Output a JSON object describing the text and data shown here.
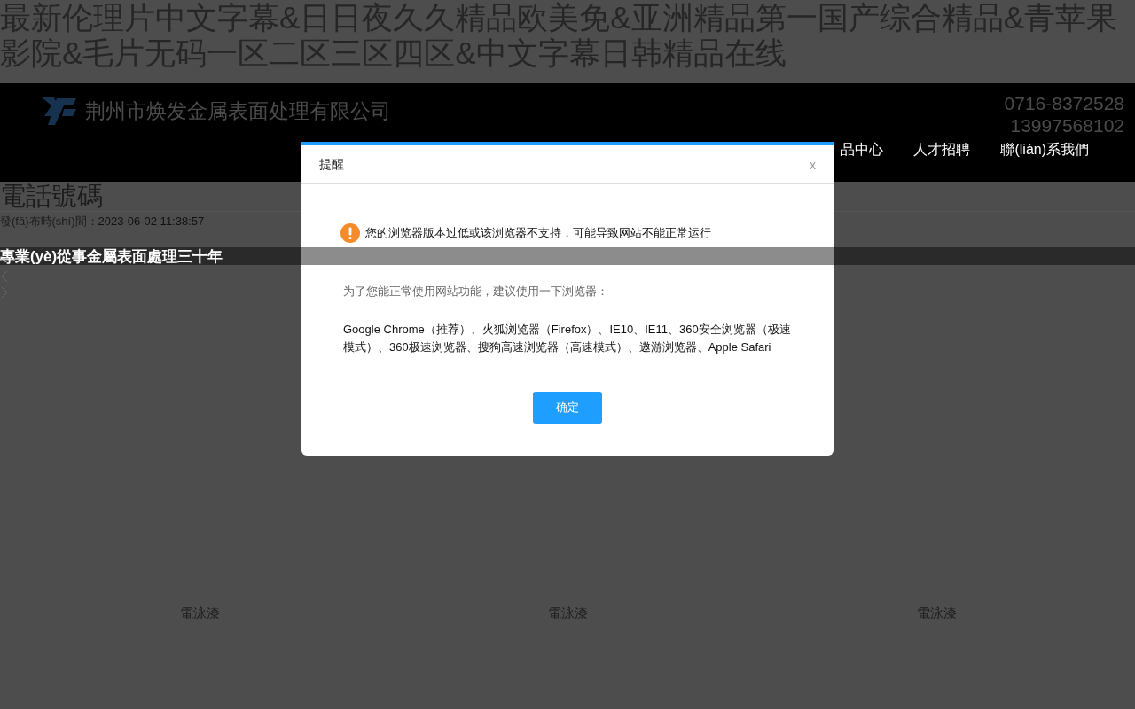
{
  "page_title": "最新伦理片中文字幕&日日夜久久精品欧美免&亚洲精品第一国产综合精品&青苹果影院&毛片无码一区二区三区四区&中文字幕日韩精品在线",
  "header": {
    "company": "荆州市焕发金属表面处理有限公司",
    "phones": [
      "0716-8372528",
      "13997568102"
    ],
    "nav": [
      {
        "label": "品中心"
      },
      {
        "label": "人才招聘"
      },
      {
        "label": "聯(lián)系我們"
      }
    ]
  },
  "article": {
    "title": "電話號碼",
    "date_label": "發(fā)布時(shí)間：",
    "date": "2023-06-02 11:38:57"
  },
  "slider": {
    "caption": "專業(yè)從事金屬表面處理三十年"
  },
  "products": [
    {
      "name": "電泳漆"
    },
    {
      "name": "電泳漆"
    },
    {
      "name": "電泳漆"
    }
  ],
  "dialog": {
    "title": "提醒",
    "close": "x",
    "warning": "您的浏览器版本过低或该浏览器不支持，可能导致网站不能正常运行",
    "intro": "为了您能正常使用网站功能，建议使用一下浏览器：",
    "browsers": "Google Chrome（推荐）、火狐浏览器（Firefox）、IE10、IE11、360安全浏览器（极速模式）、360极速浏览器、搜狗高速浏览器（高速模式）、遨游浏览器、Apple Safari",
    "button": "确定"
  }
}
